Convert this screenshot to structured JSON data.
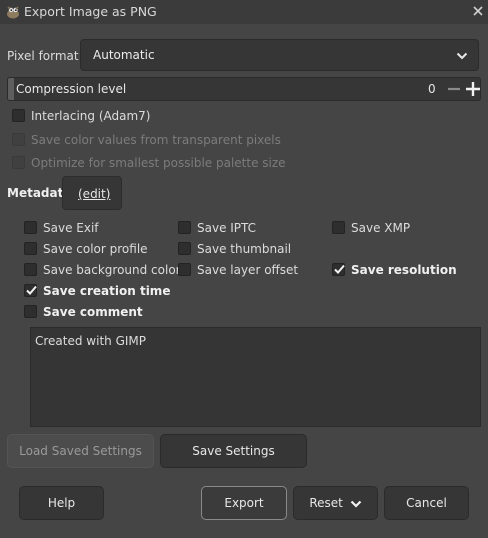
{
  "window": {
    "title": "Export Image as PNG",
    "app_icon": "gimp-wilber-icon",
    "close_icon": "close-icon"
  },
  "pixel_format": {
    "label": "Pixel format",
    "value": "Automatic"
  },
  "compression": {
    "label": "Compression level",
    "value": "0"
  },
  "options": {
    "interlacing": "Interlacing (Adam7)",
    "save_transparent": "Save color values from transparent pixels",
    "optimize_palette": "Optimize for smallest possible palette size"
  },
  "metadata": {
    "label": "Metadata",
    "edit": "(edit)",
    "save_exif": "Save Exif",
    "save_iptc": "Save IPTC",
    "save_xmp": "Save XMP",
    "save_color_profile": "Save color profile",
    "save_thumbnail": "Save thumbnail",
    "save_background_color": "Save background color",
    "save_layer_offset": "Save layer offset",
    "save_resolution": "Save resolution",
    "save_creation_time": "Save creation time",
    "save_comment": "Save comment",
    "comment_text": "Created with GIMP"
  },
  "buttons": {
    "load_saved": "Load Saved Settings",
    "save_settings": "Save Settings",
    "help": "Help",
    "export": "Export",
    "reset": "Reset",
    "cancel": "Cancel"
  }
}
